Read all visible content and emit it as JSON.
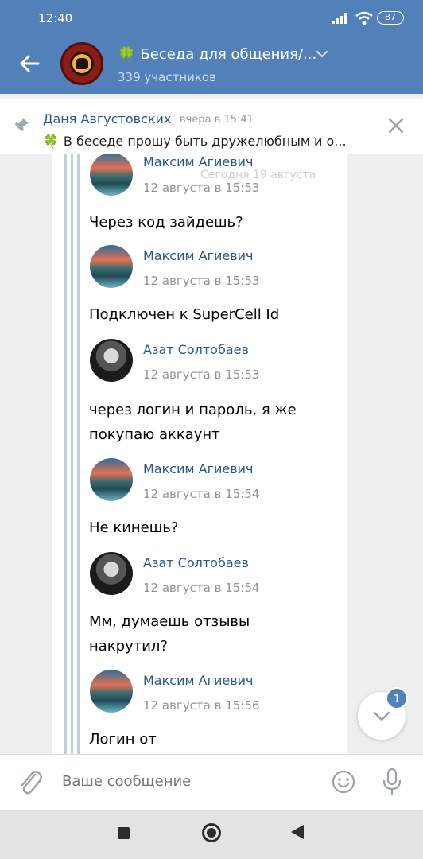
{
  "status": {
    "time": "12:40",
    "battery": "87"
  },
  "header": {
    "title": "Беседа для общения/...",
    "title_emoji": "🍀",
    "subtitle": "339 участников"
  },
  "pinned": {
    "author": "Даня Августовских",
    "time": "вчера в 15:41",
    "emoji": "🍀",
    "text": "В беседе прошу быть дружелюбным и о..."
  },
  "date_chip": "Сегодня 19 августа",
  "messages": [
    {
      "author": "Максим Агиевич",
      "date": "12 августа в 15:53",
      "text": "Через код зайдешь?",
      "avatar": "mountain"
    },
    {
      "author": "Максим Агиевич",
      "date": "12 августа в 15:53",
      "text": "Подключен к SuperCell Id",
      "avatar": "mountain"
    },
    {
      "author": "Азат Солтобаев",
      "date": "12 августа в 15:53",
      "text": "через логин и пароль, я же покупаю аккаунт",
      "avatar": "dark"
    },
    {
      "author": "Максим Агиевич",
      "date": "12 августа в 15:54",
      "text": "Не кинешь?",
      "avatar": "mountain"
    },
    {
      "author": "Азат Солтобаев",
      "date": "12 августа в 15:54",
      "text": "Мм, думаешь отзывы накрутил?",
      "avatar": "dark"
    },
    {
      "author": "Максим Агиевич",
      "date": "12 августа в 15:56",
      "text": "Логин от",
      "avatar": "mountain"
    }
  ],
  "scroll_badge": "1",
  "composer": {
    "placeholder": "Ваше сообщение"
  },
  "colors": {
    "header": "#5181b8",
    "link": "#2a5885",
    "muted": "#939393"
  }
}
